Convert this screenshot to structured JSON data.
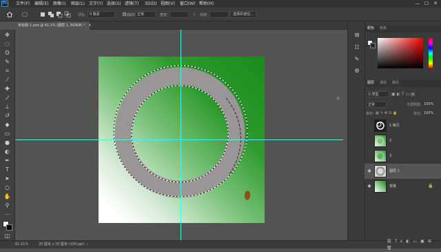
{
  "menubar": {
    "logo": "Ps",
    "items": [
      "文件(F)",
      "编辑(E)",
      "图像(I)",
      "图层(L)",
      "文字(Y)",
      "选择(S)",
      "滤镜(T)",
      "3D(D)",
      "视图(V)",
      "窗口(W)",
      "帮助(H)"
    ],
    "window_controls": [
      "—",
      "☐",
      "✕"
    ]
  },
  "options": {
    "feather_label": "羽化:",
    "feather_value": "0 像素",
    "antialias_label": "消除锯齿",
    "style_label": "样式:",
    "style_value": "正常",
    "width_label": "宽度:",
    "height_label": "高度:",
    "select_mask_button": "选择并遮住..."
  },
  "document_tab": {
    "title": "未标题-1.psd @ 61.1% (图层 1, RGB/8) *",
    "close": "×"
  },
  "status": {
    "zoom": "61.11%",
    "info": "20 厘米 x 20 厘米 (150 ppi)",
    "arrow": "›"
  },
  "panels": {
    "color_tab": "颜色",
    "swatches_tab": "色板",
    "layers_tab": "图层",
    "channels_tab": "通道",
    "paths_tab": "路径",
    "filter_kind": "Q 类型",
    "blend_mode": "正常",
    "opacity_label": "不透明度:",
    "opacity_value": "100%",
    "lock_label": "锁定:",
    "fill_label": "填充:",
    "fill_value": "100%"
  },
  "layers": [
    {
      "name": "1 拷贝",
      "visible": false,
      "selected": false
    },
    {
      "name": "2",
      "visible": false,
      "selected": false
    },
    {
      "name": "3",
      "visible": false,
      "selected": false
    },
    {
      "name": "图层 1",
      "visible": true,
      "selected": true
    },
    {
      "name": "背景",
      "visible": true,
      "selected": false
    }
  ],
  "colors": {
    "ps_blue": "#31a8ff",
    "guide": "#4ef0f0",
    "ring": "#9a9696",
    "green_dark": "#1a8a1a"
  }
}
